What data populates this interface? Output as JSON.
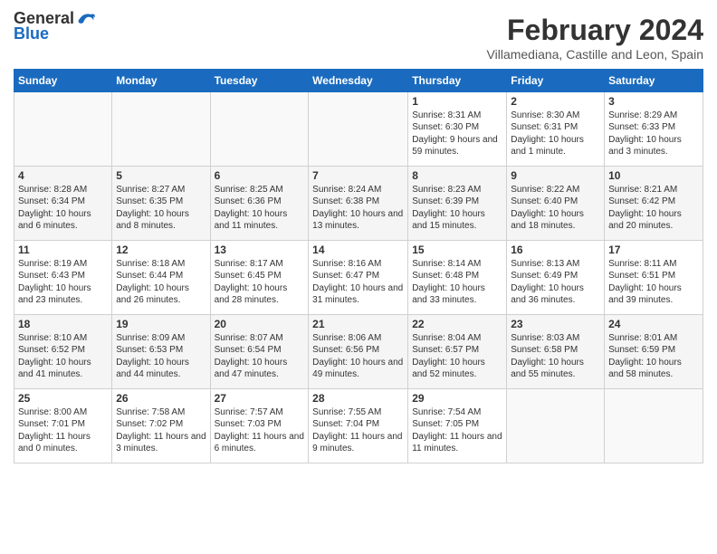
{
  "logo": {
    "line1": "General",
    "line2": "Blue"
  },
  "header": {
    "title": "February 2024",
    "location": "Villamediana, Castille and Leon, Spain"
  },
  "weekdays": [
    "Sunday",
    "Monday",
    "Tuesday",
    "Wednesday",
    "Thursday",
    "Friday",
    "Saturday"
  ],
  "weeks": [
    [
      {
        "day": "",
        "info": ""
      },
      {
        "day": "",
        "info": ""
      },
      {
        "day": "",
        "info": ""
      },
      {
        "day": "",
        "info": ""
      },
      {
        "day": "1",
        "info": "Sunrise: 8:31 AM\nSunset: 6:30 PM\nDaylight: 9 hours and 59 minutes."
      },
      {
        "day": "2",
        "info": "Sunrise: 8:30 AM\nSunset: 6:31 PM\nDaylight: 10 hours and 1 minute."
      },
      {
        "day": "3",
        "info": "Sunrise: 8:29 AM\nSunset: 6:33 PM\nDaylight: 10 hours and 3 minutes."
      }
    ],
    [
      {
        "day": "4",
        "info": "Sunrise: 8:28 AM\nSunset: 6:34 PM\nDaylight: 10 hours and 6 minutes."
      },
      {
        "day": "5",
        "info": "Sunrise: 8:27 AM\nSunset: 6:35 PM\nDaylight: 10 hours and 8 minutes."
      },
      {
        "day": "6",
        "info": "Sunrise: 8:25 AM\nSunset: 6:36 PM\nDaylight: 10 hours and 11 minutes."
      },
      {
        "day": "7",
        "info": "Sunrise: 8:24 AM\nSunset: 6:38 PM\nDaylight: 10 hours and 13 minutes."
      },
      {
        "day": "8",
        "info": "Sunrise: 8:23 AM\nSunset: 6:39 PM\nDaylight: 10 hours and 15 minutes."
      },
      {
        "day": "9",
        "info": "Sunrise: 8:22 AM\nSunset: 6:40 PM\nDaylight: 10 hours and 18 minutes."
      },
      {
        "day": "10",
        "info": "Sunrise: 8:21 AM\nSunset: 6:42 PM\nDaylight: 10 hours and 20 minutes."
      }
    ],
    [
      {
        "day": "11",
        "info": "Sunrise: 8:19 AM\nSunset: 6:43 PM\nDaylight: 10 hours and 23 minutes."
      },
      {
        "day": "12",
        "info": "Sunrise: 8:18 AM\nSunset: 6:44 PM\nDaylight: 10 hours and 26 minutes."
      },
      {
        "day": "13",
        "info": "Sunrise: 8:17 AM\nSunset: 6:45 PM\nDaylight: 10 hours and 28 minutes."
      },
      {
        "day": "14",
        "info": "Sunrise: 8:16 AM\nSunset: 6:47 PM\nDaylight: 10 hours and 31 minutes."
      },
      {
        "day": "15",
        "info": "Sunrise: 8:14 AM\nSunset: 6:48 PM\nDaylight: 10 hours and 33 minutes."
      },
      {
        "day": "16",
        "info": "Sunrise: 8:13 AM\nSunset: 6:49 PM\nDaylight: 10 hours and 36 minutes."
      },
      {
        "day": "17",
        "info": "Sunrise: 8:11 AM\nSunset: 6:51 PM\nDaylight: 10 hours and 39 minutes."
      }
    ],
    [
      {
        "day": "18",
        "info": "Sunrise: 8:10 AM\nSunset: 6:52 PM\nDaylight: 10 hours and 41 minutes."
      },
      {
        "day": "19",
        "info": "Sunrise: 8:09 AM\nSunset: 6:53 PM\nDaylight: 10 hours and 44 minutes."
      },
      {
        "day": "20",
        "info": "Sunrise: 8:07 AM\nSunset: 6:54 PM\nDaylight: 10 hours and 47 minutes."
      },
      {
        "day": "21",
        "info": "Sunrise: 8:06 AM\nSunset: 6:56 PM\nDaylight: 10 hours and 49 minutes."
      },
      {
        "day": "22",
        "info": "Sunrise: 8:04 AM\nSunset: 6:57 PM\nDaylight: 10 hours and 52 minutes."
      },
      {
        "day": "23",
        "info": "Sunrise: 8:03 AM\nSunset: 6:58 PM\nDaylight: 10 hours and 55 minutes."
      },
      {
        "day": "24",
        "info": "Sunrise: 8:01 AM\nSunset: 6:59 PM\nDaylight: 10 hours and 58 minutes."
      }
    ],
    [
      {
        "day": "25",
        "info": "Sunrise: 8:00 AM\nSunset: 7:01 PM\nDaylight: 11 hours and 0 minutes."
      },
      {
        "day": "26",
        "info": "Sunrise: 7:58 AM\nSunset: 7:02 PM\nDaylight: 11 hours and 3 minutes."
      },
      {
        "day": "27",
        "info": "Sunrise: 7:57 AM\nSunset: 7:03 PM\nDaylight: 11 hours and 6 minutes."
      },
      {
        "day": "28",
        "info": "Sunrise: 7:55 AM\nSunset: 7:04 PM\nDaylight: 11 hours and 9 minutes."
      },
      {
        "day": "29",
        "info": "Sunrise: 7:54 AM\nSunset: 7:05 PM\nDaylight: 11 hours and 11 minutes."
      },
      {
        "day": "",
        "info": ""
      },
      {
        "day": "",
        "info": ""
      }
    ]
  ]
}
